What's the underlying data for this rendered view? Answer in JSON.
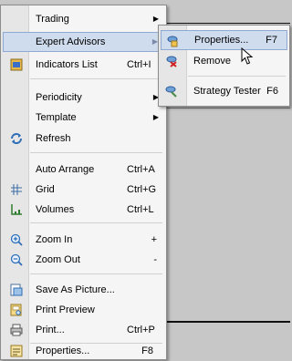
{
  "menu": {
    "items": [
      {
        "label": "Trading",
        "shortcut": "",
        "submenu": true,
        "icon": ""
      },
      {
        "label": "Expert Advisors",
        "shortcut": "",
        "submenu": true,
        "icon": "",
        "highlighted": true
      },
      {
        "label": "Indicators List",
        "shortcut": "Ctrl+I",
        "submenu": false,
        "icon": "indicators-list-icon"
      },
      {
        "label": "Periodicity",
        "shortcut": "",
        "submenu": true,
        "icon": ""
      },
      {
        "label": "Template",
        "shortcut": "",
        "submenu": true,
        "icon": ""
      },
      {
        "label": "Refresh",
        "shortcut": "",
        "submenu": false,
        "icon": "refresh-icon"
      },
      {
        "label": "Auto Arrange",
        "shortcut": "Ctrl+A",
        "submenu": false,
        "icon": ""
      },
      {
        "label": "Grid",
        "shortcut": "Ctrl+G",
        "submenu": false,
        "icon": "grid-icon"
      },
      {
        "label": "Volumes",
        "shortcut": "Ctrl+L",
        "submenu": false,
        "icon": "volumes-icon"
      },
      {
        "label": "Zoom In",
        "shortcut": "+",
        "submenu": false,
        "icon": "zoom-in-icon"
      },
      {
        "label": "Zoom Out",
        "shortcut": "-",
        "submenu": false,
        "icon": "zoom-out-icon"
      },
      {
        "label": "Save As Picture...",
        "shortcut": "",
        "submenu": false,
        "icon": "save-picture-icon"
      },
      {
        "label": "Print Preview",
        "shortcut": "",
        "submenu": false,
        "icon": "print-preview-icon"
      },
      {
        "label": "Print...",
        "shortcut": "Ctrl+P",
        "submenu": false,
        "icon": "printer-icon"
      },
      {
        "label": "Properties...",
        "shortcut": "F8",
        "submenu": false,
        "icon": "properties-icon"
      }
    ]
  },
  "submenu": {
    "items": [
      {
        "label": "Properties...",
        "shortcut": "F7",
        "icon": "expert-properties-icon",
        "highlighted": true
      },
      {
        "label": "Remove",
        "shortcut": "",
        "icon": "expert-remove-icon"
      },
      {
        "label": "Strategy Tester",
        "shortcut": "F6",
        "icon": "strategy-tester-icon"
      }
    ]
  },
  "colors": {
    "highlight": "#cfdcee",
    "highlight_border": "#8fa9d2",
    "menu_bg": "#f5f5f5",
    "gutter": "#e6e6e6",
    "desktop": "#c7c7c7"
  }
}
